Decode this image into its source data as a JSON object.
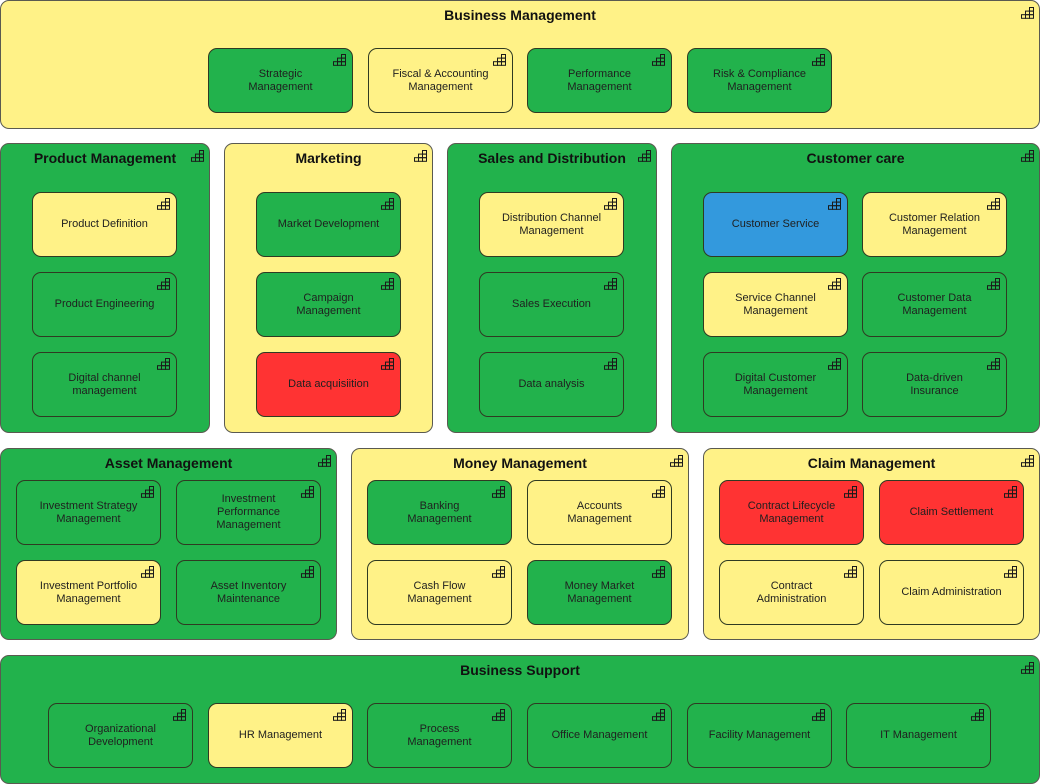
{
  "colors": {
    "green": "#22b24c",
    "yellow": "#fff287",
    "red": "#ff3333",
    "blue": "#3399dd"
  },
  "icon": "capability-icon",
  "groups": [
    {
      "title": "Business Management",
      "color": "yellow",
      "children": [
        {
          "label": "Strategic Management",
          "color": "green"
        },
        {
          "label": "Fiscal & Accounting Management",
          "color": "yellow"
        },
        {
          "label": "Performance Management",
          "color": "green"
        },
        {
          "label": "Risk & Compliance Management",
          "color": "green"
        }
      ]
    },
    {
      "title": "Product Management",
      "color": "green",
      "children": [
        {
          "label": "Product Definition",
          "color": "yellow"
        },
        {
          "label": "Product Engineering",
          "color": "green"
        },
        {
          "label": "Digital channel management",
          "color": "green"
        }
      ]
    },
    {
      "title": "Marketing",
      "color": "yellow",
      "children": [
        {
          "label": "Market Development",
          "color": "green"
        },
        {
          "label": "Campaign Management",
          "color": "green"
        },
        {
          "label": "Data acquisiition",
          "color": "red"
        }
      ]
    },
    {
      "title": "Sales and Distribution",
      "color": "green",
      "children": [
        {
          "label": "Distribution Channel Management",
          "color": "yellow"
        },
        {
          "label": "Sales Execution",
          "color": "green"
        },
        {
          "label": "Data analysis",
          "color": "green"
        }
      ]
    },
    {
      "title": "Customer care",
      "color": "green",
      "children": [
        {
          "label": "Customer Service",
          "color": "blue"
        },
        {
          "label": "Customer Relation Management",
          "color": "yellow"
        },
        {
          "label": "Service Channel Management",
          "color": "yellow"
        },
        {
          "label": "Customer Data Management",
          "color": "green"
        },
        {
          "label": "Digital Customer Management",
          "color": "green"
        },
        {
          "label": "Data-driven Insurance",
          "color": "green"
        }
      ]
    },
    {
      "title": "Asset Management",
      "color": "green",
      "children": [
        {
          "label": "Investment Strategy Management",
          "color": "green"
        },
        {
          "label": "Investment Performance Management",
          "color": "green"
        },
        {
          "label": "Investment Portfolio Management",
          "color": "yellow"
        },
        {
          "label": "Asset Inventory Maintenance",
          "color": "green"
        }
      ]
    },
    {
      "title": "Money Management",
      "color": "yellow",
      "children": [
        {
          "label": "Banking Management",
          "color": "green"
        },
        {
          "label": "Accounts Management",
          "color": "yellow"
        },
        {
          "label": "Cash Flow Management",
          "color": "yellow"
        },
        {
          "label": "Money Market Management",
          "color": "green"
        }
      ]
    },
    {
      "title": "Claim Management",
      "color": "yellow",
      "children": [
        {
          "label": "Contract Lifecycle Management",
          "color": "red"
        },
        {
          "label": "Claim Settlement",
          "color": "red"
        },
        {
          "label": "Contract Administration",
          "color": "yellow"
        },
        {
          "label": "Claim Administration",
          "color": "yellow"
        }
      ]
    },
    {
      "title": "Business Support",
      "color": "green",
      "children": [
        {
          "label": "Organizational Development",
          "color": "green"
        },
        {
          "label": "HR Management",
          "color": "yellow"
        },
        {
          "label": "Process Management",
          "color": "green"
        },
        {
          "label": "Office Management",
          "color": "green"
        },
        {
          "label": "Facility Management",
          "color": "green"
        },
        {
          "label": "IT Management",
          "color": "green"
        }
      ]
    }
  ]
}
